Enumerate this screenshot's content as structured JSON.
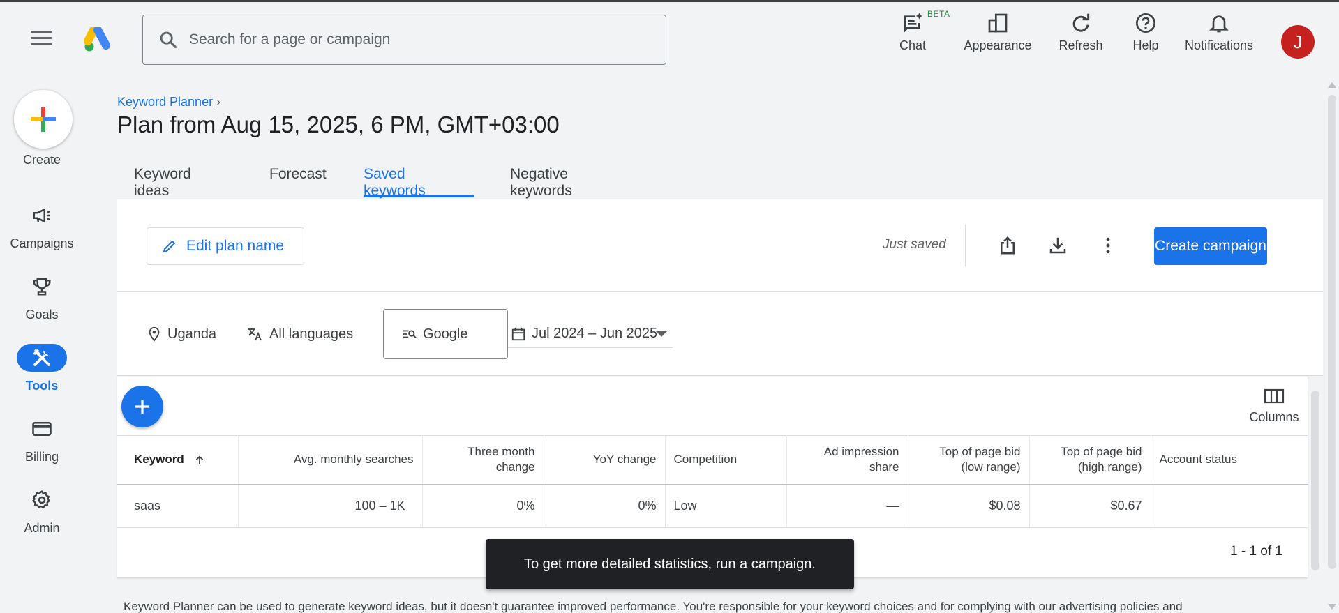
{
  "header": {
    "search_placeholder": "Search for a page or campaign",
    "items": [
      {
        "label": "Chat",
        "icon": "chat-spark-icon"
      },
      {
        "label": "Appearance",
        "icon": "appearance-icon"
      },
      {
        "label": "Refresh",
        "icon": "refresh-icon"
      },
      {
        "label": "Help",
        "icon": "help-icon"
      },
      {
        "label": "Notifications",
        "icon": "bell-icon"
      }
    ],
    "beta": "BETA",
    "avatar_letter": "J",
    "avatar_color": "#c5221f"
  },
  "sidebar": {
    "create_label": "Create",
    "items": [
      {
        "label": "Campaigns",
        "icon": "megaphone-icon"
      },
      {
        "label": "Goals",
        "icon": "trophy-icon"
      },
      {
        "label": "Tools",
        "icon": "tools-icon",
        "active": true
      },
      {
        "label": "Billing",
        "icon": "credit-card-icon"
      },
      {
        "label": "Admin",
        "icon": "gear-icon"
      }
    ]
  },
  "page": {
    "breadcrumb": "Keyword Planner",
    "title": "Plan from Aug 15, 2025, 6 PM, GMT+03:00",
    "tabs": [
      "Keyword ideas",
      "Forecast",
      "Saved keywords",
      "Negative keywords"
    ],
    "active_tab": "Saved keywords"
  },
  "toolbar": {
    "edit_label": "Edit plan name",
    "status": "Just saved",
    "create_campaign": "Create campaign"
  },
  "filters": {
    "location": "Uganda",
    "language": "All languages",
    "network": "Google",
    "date_range": "Jul 2024 – Jun 2025"
  },
  "table": {
    "columns_label": "Columns",
    "headers": [
      "Keyword",
      "Avg. monthly searches",
      "Three month change",
      "YoY change",
      "Competition",
      "Ad impression share",
      "Top of page bid (low range)",
      "Top of page bid (high range)",
      "Account status"
    ],
    "rows": [
      {
        "keyword": "saas",
        "avg_monthly": "100 – 1K",
        "three_month": "0%",
        "yoy": "0%",
        "competition": "Low",
        "impression_share": "—",
        "bid_low": "$0.08",
        "bid_high": "$0.67",
        "account_status": ""
      }
    ],
    "pagination": "1 - 1 of 1"
  },
  "toast": "To get more detailed statistics, run a campaign.",
  "footer": "Keyword Planner can be used to generate keyword ideas, but it doesn't guarantee improved performance. You're responsible for your keyword choices and for complying with our advertising policies and",
  "colors": {
    "accent": "#1a73e8",
    "background": "#f1f3f4"
  }
}
